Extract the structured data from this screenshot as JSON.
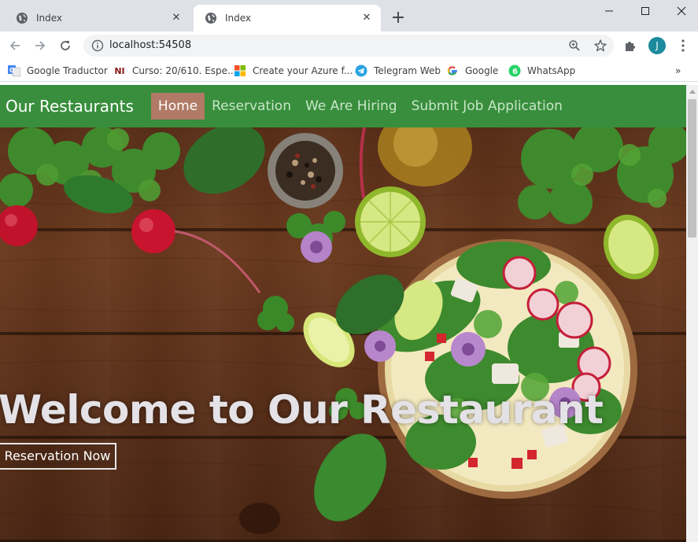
{
  "browser": {
    "tabs": [
      {
        "title": "Index",
        "active": false
      },
      {
        "title": "Index",
        "active": true
      }
    ],
    "new_tab_symbol": "+",
    "close_symbol": "✕",
    "url": "localhost:54508",
    "profile_initial": "J",
    "bookmarks": [
      {
        "label": "Google Traductor",
        "icon": "google-translate-icon"
      },
      {
        "label": "Curso: 20/610. Espe...",
        "icon": "ni-logo-icon"
      },
      {
        "label": "Create your Azure f...",
        "icon": "microsoft-logo-icon"
      },
      {
        "label": "Telegram Web",
        "icon": "telegram-icon"
      },
      {
        "label": "Google",
        "icon": "google-g-icon"
      },
      {
        "label": "WhatsApp",
        "icon": "whatsapp-icon"
      }
    ],
    "bookmarks_more": "»"
  },
  "site": {
    "brand": "Our Restaurants",
    "nav": [
      {
        "label": "Home",
        "active": true
      },
      {
        "label": "Reservation",
        "active": false
      },
      {
        "label": "We Are Hiring",
        "active": false
      },
      {
        "label": "Submit Job Application",
        "active": false
      }
    ],
    "hero_title": "Welcome to Our Restaurant",
    "hero_button": "Reservation Now"
  },
  "colors": {
    "navbar": "#388e3c",
    "active_nav": "#b07a66",
    "tabstrip": "#dee1e6"
  }
}
